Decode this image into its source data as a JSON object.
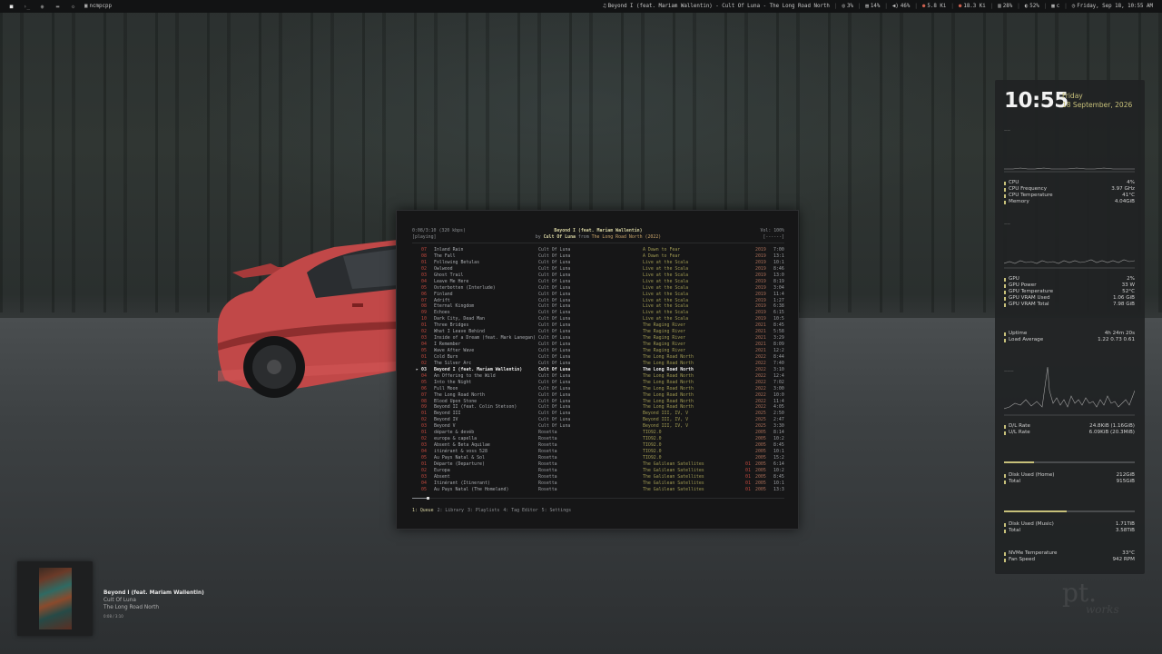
{
  "topbar": {
    "workspaces": [
      "",
      "",
      "",
      "",
      "",
      "",
      ""
    ],
    "active_app": "ncmpcpp",
    "now_playing": "Beyond I (feat. Mariam Wallentin) - Cult Of Luna - The Long Road North",
    "cpu": "3%",
    "mem": "14%",
    "volume": "46%",
    "net_down": "5.8 Ki",
    "net_up": "18.3 Ki",
    "disk": "28%",
    "battery": "52%",
    "layout": "c",
    "datetime": "Friday, Sep 18, 10:55 AM"
  },
  "player": {
    "elapsed": "0:08/3:10 (320 kbps)",
    "state": "[playing]",
    "title": "Beyond I (feat. Mariam Wallentin)",
    "by_prefix": "by",
    "artist": "Cult Of Luna",
    "from_prefix": "from",
    "album_year": "The Long Road North (2022)",
    "volume": "Vol: 100%",
    "flags": "[------]",
    "progress": 0.042,
    "playlist": [
      {
        "tn": "07",
        "title": "Inland Rain",
        "artist": "Cult Of Luna",
        "album": "A Dawn to Fear",
        "disc": "",
        "year": "2019",
        "dur": "7:00"
      },
      {
        "tn": "08",
        "title": "The Fall",
        "artist": "Cult Of Luna",
        "album": "A Dawn to Fear",
        "disc": "",
        "year": "2019",
        "dur": "13:1"
      },
      {
        "tn": "01",
        "title": "Following Betulas",
        "artist": "Cult Of Luna",
        "album": "Live at the Scala",
        "disc": "",
        "year": "2019",
        "dur": "10:1"
      },
      {
        "tn": "02",
        "title": "Owlwood",
        "artist": "Cult Of Luna",
        "album": "Live at the Scala",
        "disc": "",
        "year": "2019",
        "dur": "8:46"
      },
      {
        "tn": "03",
        "title": "Ghost Trail",
        "artist": "Cult Of Luna",
        "album": "Live at the Scala",
        "disc": "",
        "year": "2019",
        "dur": "13:0"
      },
      {
        "tn": "04",
        "title": "Leave Me Here",
        "artist": "Cult Of Luna",
        "album": "Live at the Scala",
        "disc": "",
        "year": "2019",
        "dur": "8:19"
      },
      {
        "tn": "05",
        "title": "Osterbotten (Interlude)",
        "artist": "Cult Of Luna",
        "album": "Live at the Scala",
        "disc": "",
        "year": "2019",
        "dur": "3:04"
      },
      {
        "tn": "06",
        "title": "Finland",
        "artist": "Cult Of Luna",
        "album": "Live at the Scala",
        "disc": "",
        "year": "2019",
        "dur": "11:4"
      },
      {
        "tn": "07",
        "title": "Adrift",
        "artist": "Cult Of Luna",
        "album": "Live at the Scala",
        "disc": "",
        "year": "2019",
        "dur": "1:27"
      },
      {
        "tn": "08",
        "title": "Eternal Kingdom",
        "artist": "Cult Of Luna",
        "album": "Live at the Scala",
        "disc": "",
        "year": "2019",
        "dur": "6:38"
      },
      {
        "tn": "09",
        "title": "Echoes",
        "artist": "Cult Of Luna",
        "album": "Live at the Scala",
        "disc": "",
        "year": "2019",
        "dur": "6:15"
      },
      {
        "tn": "10",
        "title": "Dark City, Dead Man",
        "artist": "Cult Of Luna",
        "album": "Live at the Scala",
        "disc": "",
        "year": "2019",
        "dur": "10:5"
      },
      {
        "tn": "01",
        "title": "Three Bridges",
        "artist": "Cult Of Luna",
        "album": "The Raging River",
        "disc": "",
        "year": "2021",
        "dur": "8:45"
      },
      {
        "tn": "02",
        "title": "What I Leave Behind",
        "artist": "Cult Of Luna",
        "album": "The Raging River",
        "disc": "",
        "year": "2021",
        "dur": "5:58"
      },
      {
        "tn": "03",
        "title": "Inside of a Dream (feat. Mark Lanegan)",
        "artist": "Cult Of Luna",
        "album": "The Raging River",
        "disc": "",
        "year": "2021",
        "dur": "3:29"
      },
      {
        "tn": "04",
        "title": "I Remember",
        "artist": "Cult Of Luna",
        "album": "The Raging River",
        "disc": "",
        "year": "2021",
        "dur": "8:09"
      },
      {
        "tn": "05",
        "title": "Wave After Wave",
        "artist": "Cult Of Luna",
        "album": "The Raging River",
        "disc": "",
        "year": "2021",
        "dur": "12:2"
      },
      {
        "tn": "01",
        "title": "Cold Burn",
        "artist": "Cult Of Luna",
        "album": "The Long Road North",
        "disc": "",
        "year": "2022",
        "dur": "8:44"
      },
      {
        "tn": "02",
        "title": "The Silver Arc",
        "artist": "Cult Of Luna",
        "album": "The Long Road North",
        "disc": "",
        "year": "2022",
        "dur": "7:40"
      },
      {
        "tn": "03",
        "title": "Beyond I (feat. Mariam Wallentin)",
        "artist": "Cult Of Luna",
        "album": "The Long Road North",
        "disc": "",
        "year": "2022",
        "dur": "3:10",
        "current": true
      },
      {
        "tn": "04",
        "title": "An Offering to the Wild",
        "artist": "Cult Of Luna",
        "album": "The Long Road North",
        "disc": "",
        "year": "2022",
        "dur": "12:4"
      },
      {
        "tn": "05",
        "title": "Into the Night",
        "artist": "Cult Of Luna",
        "album": "The Long Road North",
        "disc": "",
        "year": "2022",
        "dur": "7:02"
      },
      {
        "tn": "06",
        "title": "Full Moon",
        "artist": "Cult Of Luna",
        "album": "The Long Road North",
        "disc": "",
        "year": "2022",
        "dur": "3:00"
      },
      {
        "tn": "07",
        "title": "The Long Road North",
        "artist": "Cult Of Luna",
        "album": "The Long Road North",
        "disc": "",
        "year": "2022",
        "dur": "10:0"
      },
      {
        "tn": "08",
        "title": "Blood Upon Stone",
        "artist": "Cult Of Luna",
        "album": "The Long Road North",
        "disc": "",
        "year": "2022",
        "dur": "11:4"
      },
      {
        "tn": "09",
        "title": "Beyond II (feat. Colin Stetson)",
        "artist": "Cult Of Luna",
        "album": "The Long Road North",
        "disc": "",
        "year": "2022",
        "dur": "4:05"
      },
      {
        "tn": "01",
        "title": "Beyond III",
        "artist": "Cult Of Luna",
        "album": "Beyond III, IV, V",
        "disc": "",
        "year": "2025",
        "dur": "2:50"
      },
      {
        "tn": "02",
        "title": "Beyond IV",
        "artist": "Cult Of Luna",
        "album": "Beyond III, IV, V",
        "disc": "",
        "year": "2025",
        "dur": "2:47"
      },
      {
        "tn": "03",
        "title": "Beyond V",
        "artist": "Cult Of Luna",
        "album": "Beyond III, IV, V",
        "disc": "",
        "year": "2025",
        "dur": "3:30"
      },
      {
        "tn": "01",
        "title": "départe & devéb",
        "artist": "Rosetta",
        "album": "TIO92.0",
        "disc": "",
        "year": "2005",
        "dur": "8:14"
      },
      {
        "tn": "02",
        "title": "europa & capella",
        "artist": "Rosetta",
        "album": "TIO92.0",
        "disc": "",
        "year": "2005",
        "dur": "10:2"
      },
      {
        "tn": "03",
        "title": "Absent & Beta Aquilae",
        "artist": "Rosetta",
        "album": "TIO92.0",
        "disc": "",
        "year": "2005",
        "dur": "8:45"
      },
      {
        "tn": "04",
        "title": "itinérant & voss 528",
        "artist": "Rosetta",
        "album": "TIO92.0",
        "disc": "",
        "year": "2005",
        "dur": "10:1"
      },
      {
        "tn": "05",
        "title": "Au Pays Natal & Sol",
        "artist": "Rosetta",
        "album": "TIO92.0",
        "disc": "",
        "year": "2005",
        "dur": "15:2"
      },
      {
        "tn": "01",
        "title": "Départe (Departure)",
        "artist": "Rosetta",
        "album": "The Galilean Satellites",
        "disc": "01",
        "year": "2005",
        "dur": "6:14"
      },
      {
        "tn": "02",
        "title": "Europa",
        "artist": "Rosetta",
        "album": "The Galilean Satellites",
        "disc": "01",
        "year": "2005",
        "dur": "10:2"
      },
      {
        "tn": "03",
        "title": "Absent",
        "artist": "Rosetta",
        "album": "The Galilean Satellites",
        "disc": "01",
        "year": "2005",
        "dur": "8:45"
      },
      {
        "tn": "04",
        "title": "Itinérant (Itinerant)",
        "artist": "Rosetta",
        "album": "The Galilean Satellites",
        "disc": "01",
        "year": "2005",
        "dur": "10:1"
      },
      {
        "tn": "05",
        "title": "Au Pays Natal (The Homeland)",
        "artist": "Rosetta",
        "album": "The Galilean Satellites",
        "disc": "01",
        "year": "2005",
        "dur": "13:3"
      }
    ],
    "tabs": [
      {
        "label": "1: Queue",
        "active": true
      },
      {
        "label": "2: Library",
        "active": false
      },
      {
        "label": "3: Playlists",
        "active": false
      },
      {
        "label": "4: Tag Editor",
        "active": false
      },
      {
        "label": "5: Settings",
        "active": false
      }
    ]
  },
  "conky": {
    "time": "10:55",
    "day": "Friday",
    "date": "18 September, 2026",
    "cpu_block": [
      {
        "k": "CPU",
        "v": "4%"
      },
      {
        "k": "CPU Frequency",
        "v": "3.97 GHz"
      },
      {
        "k": "CPU Temperature",
        "v": "41°C"
      },
      {
        "k": "Memory",
        "v": "4.04GiB"
      }
    ],
    "gpu_block": [
      {
        "k": "GPU",
        "v": "2%"
      },
      {
        "k": "GPU Power",
        "v": "33 W"
      },
      {
        "k": "GPU Temperature",
        "v": "52°C"
      },
      {
        "k": "GPU VRAM Used",
        "v": "1.06 GiB"
      },
      {
        "k": "GPU VRAM Total",
        "v": "7.98 GiB"
      }
    ],
    "sys_block": [
      {
        "k": "Uptime",
        "v": "4h 24m 20s"
      },
      {
        "k": "Load Average",
        "v": "1.22 0.73 0.61"
      }
    ],
    "net_block": [
      {
        "k": "D/L Rate",
        "v": "24.8KiB (1.16GiB)"
      },
      {
        "k": "U/L Rate",
        "v": "6.09KiB (20.3MiB)"
      }
    ],
    "home_block": [
      {
        "k": "Disk Used (Home)",
        "v": "212GiB"
      },
      {
        "k": "Total",
        "v": "915GiB"
      }
    ],
    "home_used_fraction": 0.23,
    "music_block": [
      {
        "k": "Disk Used (Music)",
        "v": "1.71TiB"
      },
      {
        "k": "Total",
        "v": "3.58TiB"
      }
    ],
    "music_used_fraction": 0.48,
    "misc_block": [
      {
        "k": "NVMe Temperature",
        "v": "33°C"
      },
      {
        "k": "Fan Speed",
        "v": "942 RPM"
      }
    ]
  },
  "notification": {
    "title": "Beyond I (feat. Mariam Wallentin)",
    "artist": "Cult Of Luna",
    "album": "The Long Road North",
    "time": "0:08 / 3:10"
  },
  "watermark": {
    "big": "pt.",
    "small": "works"
  }
}
